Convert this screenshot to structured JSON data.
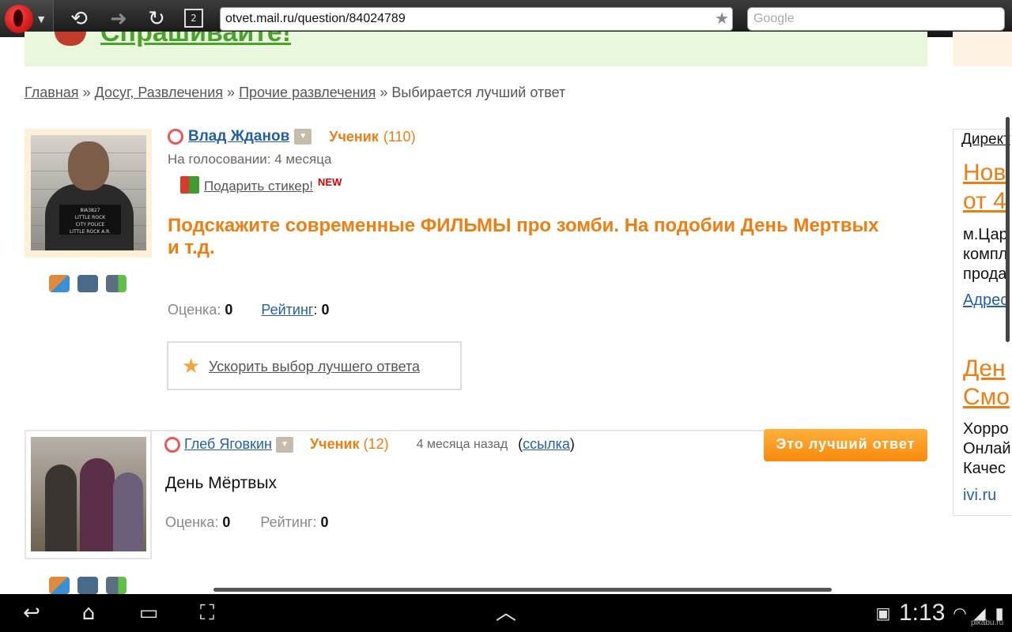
{
  "browser": {
    "url": "otvet.mail.ru/question/84024789",
    "search_placeholder": "Google",
    "tabs_count": "2"
  },
  "banner": {
    "text": "Спрашивайте!"
  },
  "breadcrumb": {
    "items": [
      "Главная",
      "Досуг, Развлечения",
      "Прочие развлечения"
    ],
    "separator": "»",
    "current": "Выбирается лучший ответ"
  },
  "question": {
    "author": "Влад Жданов",
    "rank": "Ученик",
    "rank_points": "(110)",
    "status": "На голосовании: 4 месяца",
    "gift_label": "Подарить стикер!",
    "new_badge": "NEW",
    "text": "Подскажите современные ФИЛЬМЫ про зомби. На подобии День Мертвых и т.д.",
    "score_label": "Оценка:",
    "score_value": "0",
    "rating_label": "Рейтинг",
    "rating_value": "0",
    "speed_label": "Ускорить выбор лучшего ответа",
    "mugshot_lines": [
      "8IA3827",
      "LITTLE ROCK",
      "CITY POLICE",
      "LITTLE ROCK A.R."
    ]
  },
  "answer": {
    "author": "Глеб Яговкин",
    "rank": "Ученик",
    "rank_points": "(12)",
    "time": "4 месяца назад",
    "link_label": "ссылка",
    "best_button": "Это лучший ответ",
    "text": "День Мёртвых",
    "score_label": "Оценка:",
    "score_value": "0",
    "rating_label": "Рейтинг:",
    "rating_value": "0"
  },
  "ad": {
    "header": "Директ",
    "title1a": "Нов",
    "title1b": "от 4",
    "body1a": "м.Цар",
    "body1b": "компл",
    "body1c": "прода",
    "link1": "Адрес",
    "title2a": "Ден",
    "title2b": "Смо",
    "body2a": "Хорро",
    "body2b": "Онлай",
    "body2c": "Качес",
    "domain": "ivi.ru"
  },
  "system": {
    "clock": "1:13",
    "watermark": "pikabu.ru"
  },
  "colors": {
    "orange": "#ef7e12",
    "link_blue": "#245ea7",
    "green": "#4aa12c"
  }
}
